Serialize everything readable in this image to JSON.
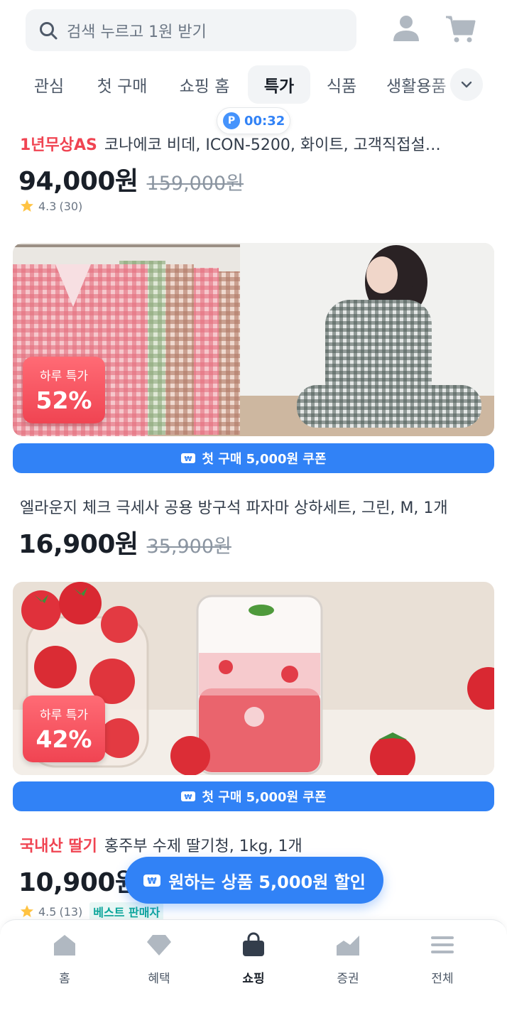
{
  "header": {
    "search_placeholder": "검색 누르고 1원 받기",
    "account_icon": "person-icon",
    "cart_icon": "cart-icon"
  },
  "tabs": [
    {
      "label": "관심",
      "active": false
    },
    {
      "label": "첫 구매",
      "active": false
    },
    {
      "label": "쇼핑 홈",
      "active": false
    },
    {
      "label": "특가",
      "active": true
    },
    {
      "label": "식품",
      "active": false
    },
    {
      "label": "생활용품",
      "active": false
    }
  ],
  "timer": {
    "badge": "P",
    "time": "00:32"
  },
  "products": [
    {
      "tag": "1년무상AS",
      "name": "코나에코 비데, ICON-5200, 화이트, 고객직접설…",
      "price": "94,000원",
      "original_price": "159,000원",
      "rating": "4.3",
      "reviews": "(30)"
    },
    {
      "deal_label": "하루 특가",
      "deal_percent": "52%",
      "coupon": "첫 구매 5,000원 쿠폰",
      "name": "엘라운지 체크 극세사 공용 방구석 파자마 상하세트, 그린, M, 1개",
      "price": "16,900원",
      "original_price": "35,900원"
    },
    {
      "deal_label": "하루 특가",
      "deal_percent": "42%",
      "coupon": "첫 구매 5,000원 쿠폰",
      "tag": "국내산 딸기",
      "name": "홍주부 수제 딸기청, 1kg, 1개",
      "price": "10,900원",
      "rating": "4.5",
      "reviews": "(13)",
      "seller_badge": "베스트 판매자"
    }
  ],
  "floating_button": "원하는 상품 5,000원 할인",
  "bottom_nav": [
    {
      "label": "홈",
      "icon": "home-icon",
      "active": false
    },
    {
      "label": "혜택",
      "icon": "diamond-icon",
      "active": false
    },
    {
      "label": "쇼핑",
      "icon": "shopping-bag-icon",
      "active": true
    },
    {
      "label": "증권",
      "icon": "chart-icon",
      "active": false
    },
    {
      "label": "전체",
      "icon": "menu-icon",
      "active": false
    }
  ],
  "colors": {
    "accent": "#3182f6",
    "sale_red": "#f04452",
    "text": "#191f28"
  }
}
